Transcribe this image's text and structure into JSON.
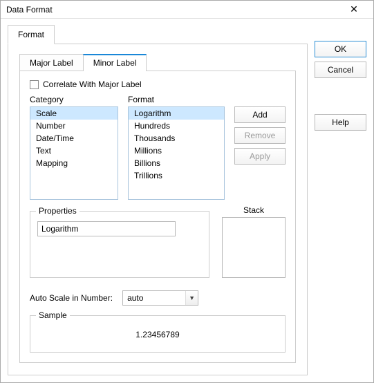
{
  "title": "Data Format",
  "outer_tab": "Format",
  "inner_tabs": {
    "major": "Major Label",
    "minor": "Minor Label"
  },
  "correlate_label": "Correlate With Major Label",
  "category": {
    "label": "Category",
    "items": [
      "Scale",
      "Number",
      "Date/Time",
      "Text",
      "Mapping"
    ],
    "selected": "Scale"
  },
  "format": {
    "label": "Format",
    "items": [
      "Logarithm",
      "Hundreds",
      "Thousands",
      "Millions",
      "Billions",
      "Trillions"
    ],
    "selected": "Logarithm"
  },
  "actions": {
    "add": "Add",
    "remove": "Remove",
    "apply": "Apply"
  },
  "properties": {
    "legend": "Properties",
    "value": "Logarithm"
  },
  "stack": {
    "label": "Stack"
  },
  "autoscale": {
    "label": "Auto Scale in Number:",
    "value": "auto"
  },
  "sample": {
    "legend": "Sample",
    "value": "1.23456789"
  },
  "buttons": {
    "ok": "OK",
    "cancel": "Cancel",
    "help": "Help"
  }
}
